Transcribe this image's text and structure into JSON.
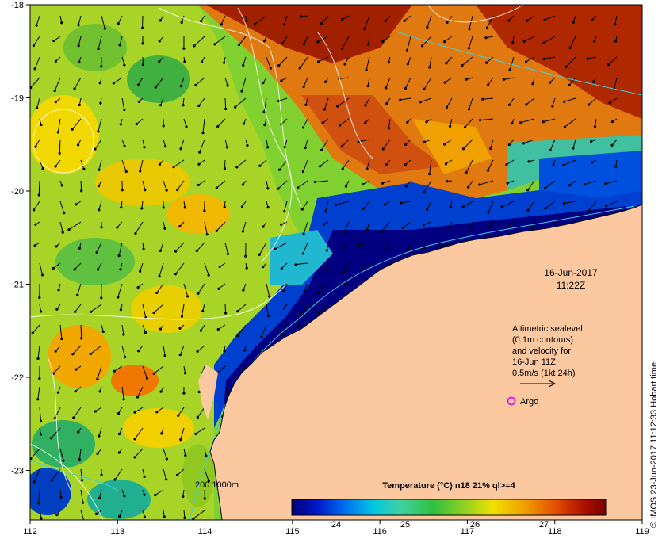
{
  "map": {
    "date": "16-Jun-2017",
    "time": "11:22Z",
    "legend_lines": [
      "Altimetric sealevel",
      "(0.1m contours)",
      "and velocity for",
      "16-Jun 11Z",
      "0.5m/s (1kt 24h)"
    ],
    "argo_label": "Argo",
    "depth_label": "200  1000m",
    "credit": "© IMOS 23-Jun-2017 11:12:33 Hobart time",
    "x_ticks": [
      "112",
      "113",
      "114",
      "115",
      "116",
      "117",
      "118",
      "119"
    ],
    "y_ticks": [
      "-18",
      "-19",
      "-20",
      "-21",
      "-22",
      "-23"
    ],
    "colors": {
      "land": "#fcc8a0",
      "argo": "#e020e0",
      "contour": "#ffffff",
      "isobath": "#40d0e0"
    }
  },
  "colorbar": {
    "title": "Temperature (°C) n18 21% ql>=4",
    "ticks": [
      "24",
      "25",
      "26",
      "27"
    ],
    "stops": [
      "#00007a",
      "#0018c8",
      "#0070f0",
      "#00c8e0",
      "#40d0a0",
      "#30c040",
      "#90d020",
      "#f0e000",
      "#f0a000",
      "#e05000",
      "#b01000",
      "#780000"
    ]
  }
}
